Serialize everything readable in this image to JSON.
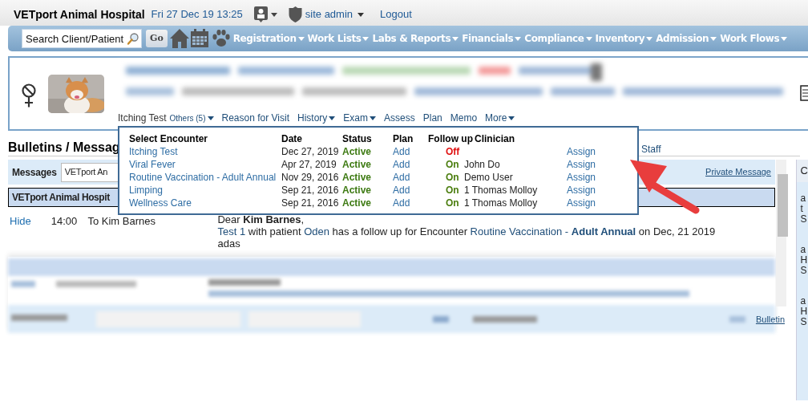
{
  "header": {
    "title": "VETport Animal Hospital",
    "datetime": "Fri 27 Dec 19 13:25",
    "user": "site admin",
    "logout": "Logout"
  },
  "nav": {
    "search_placeholder": "Search Client/Patient",
    "go": "Go",
    "menus": [
      "Registration",
      "Work Lists",
      "Labs & Reports",
      "Financials",
      "Compliance",
      "Inventory",
      "Admission",
      "Work Flows"
    ]
  },
  "patient_tabs": [
    {
      "label": "Itching Test",
      "kind": "encounter",
      "dropdown": false
    },
    {
      "label": "Others (5)",
      "kind": "others",
      "dropdown": true
    },
    {
      "label": "Reason for Visit",
      "kind": "link",
      "dropdown": false
    },
    {
      "label": "History",
      "kind": "link",
      "dropdown": true
    },
    {
      "label": "Exam",
      "kind": "link",
      "dropdown": true
    },
    {
      "label": "Assess",
      "kind": "link",
      "dropdown": false
    },
    {
      "label": "Plan",
      "kind": "link",
      "dropdown": false
    },
    {
      "label": "Memo",
      "kind": "link",
      "dropdown": false
    },
    {
      "label": "More",
      "kind": "link",
      "dropdown": true
    }
  ],
  "encounter_popup": {
    "columns": [
      "Select Encounter",
      "Date",
      "Status",
      "Plan",
      "Follow up",
      "Clinician"
    ],
    "rows": [
      {
        "encounter": "Itching Test",
        "date": "Dec 27, 2019",
        "status": "Active",
        "plan": "Add",
        "follow_up": "Off",
        "follow_up_on": false,
        "action": "Assign"
      },
      {
        "encounter": "Viral Fever",
        "date": "Apr 27, 2019",
        "status": "Active",
        "plan": "Add",
        "follow_up": "On",
        "follow_up_on": true,
        "clinician": "John Do",
        "action": "Assign"
      },
      {
        "encounter": "Routine Vaccination - Adult Annual",
        "date": "Nov 29, 2016",
        "status": "Active",
        "plan": "Add",
        "follow_up": "On",
        "follow_up_on": true,
        "clinician": "Demo User",
        "action": "Assign"
      },
      {
        "encounter": "Limping",
        "date": "Sep 21, 2016",
        "status": "Active",
        "plan": "Add",
        "follow_up": "On",
        "follow_up_on": true,
        "clinician": "1 Thomas Molloy",
        "action": "Assign"
      },
      {
        "encounter": "Wellness Care",
        "date": "Sep 21, 2016",
        "status": "Active",
        "plan": "Add",
        "follow_up": "On",
        "follow_up_on": true,
        "clinician": "1 Thomas Molloy",
        "action": "Assign"
      }
    ]
  },
  "bulletins": {
    "title": "Bulletins / Messag",
    "staff": "Staff",
    "messages_label": "Messages",
    "select_value": "VETport An",
    "private_link": "Private Message",
    "group_header": "VETport Animal Hospit",
    "message": {
      "hide": "Hide",
      "time": "14:00",
      "to": "To Kim Barnes",
      "greeting": "Dear **Kim Barnes**,",
      "body": [
        {
          "text": "Test 1",
          "kind": "link"
        },
        {
          "text": " with patient ",
          "kind": "plain"
        },
        {
          "text": "Oden",
          "kind": "link"
        },
        {
          "text": " has a follow up for Encounter ",
          "kind": "plain"
        },
        {
          "text": "Routine Vaccination - ",
          "kind": "link"
        },
        {
          "text": "Adult Annual",
          "kind": "link_bold"
        },
        {
          "text": " on Dec, 21 2019",
          "kind": "plain"
        }
      ],
      "note": "adas"
    },
    "bulletin_link": "Bulletin"
  },
  "side_panel": {
    "header": "C",
    "entries": [
      [
        "a",
        "t",
        "S"
      ],
      [
        "a",
        "H",
        "S"
      ],
      [
        "a",
        "H",
        "S"
      ]
    ]
  }
}
